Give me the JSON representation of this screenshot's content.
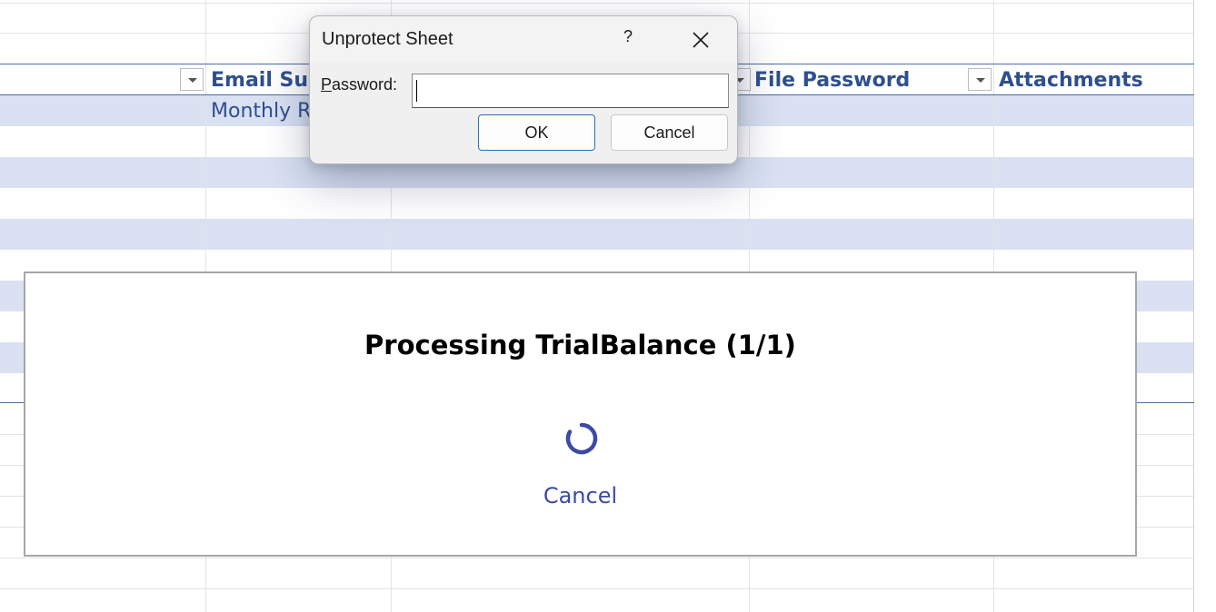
{
  "sheet": {
    "columns": [
      {
        "header": "Email Subject",
        "visible_header": "Email Subj"
      },
      {
        "header": "File Password"
      },
      {
        "header": "Attachments"
      }
    ],
    "first_row_email_subject": "Monthly R"
  },
  "unprotect_dialog": {
    "title": "Unprotect Sheet",
    "help_glyph": "?",
    "password_label_accesskey": "P",
    "password_label_rest": "assword:",
    "password_value": "",
    "ok_label": "OK",
    "cancel_label": "Cancel"
  },
  "processing": {
    "title": "Processing TrialBalance (1/1)",
    "cancel_label": "Cancel"
  },
  "colors": {
    "accent": "#3b4aa8",
    "header_text": "#2e4f8f",
    "band": "#d9e1f2"
  }
}
